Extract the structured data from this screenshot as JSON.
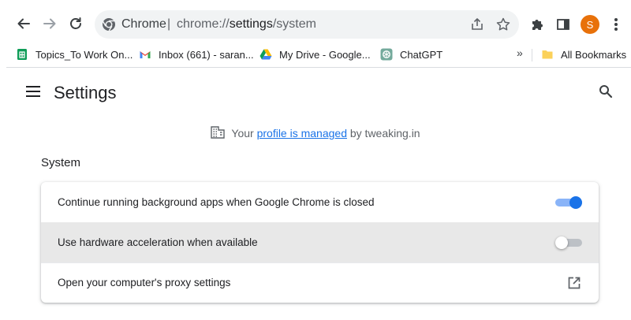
{
  "browser": {
    "omnibox": {
      "site_name": "Chrome",
      "separator": "|",
      "url_prefix": "chrome://",
      "url_host": "settings",
      "url_path": "/system"
    },
    "profile_initial": "S",
    "bookmarks": [
      {
        "label": "Topics_To Work On...",
        "icon": "google-sheets-icon"
      },
      {
        "label": "Inbox (661) - saran...",
        "icon": "gmail-icon"
      },
      {
        "label": "My Drive - Google...",
        "icon": "google-drive-icon"
      },
      {
        "label": "ChatGPT",
        "icon": "chatgpt-icon"
      }
    ],
    "bookmarks_overflow": "»",
    "all_bookmarks_label": "All Bookmarks"
  },
  "settings": {
    "title": "Settings",
    "managed_notice": {
      "prefix": "Your",
      "link": "profile is managed",
      "suffix": "by tweaking.in"
    },
    "section_title": "System",
    "rows": [
      {
        "label": "Continue running background apps when Google Chrome is closed",
        "control": "toggle",
        "enabled": true
      },
      {
        "label": "Use hardware acceleration when available",
        "control": "toggle",
        "enabled": false
      },
      {
        "label": "Open your computer's proxy settings",
        "control": "external-link"
      }
    ]
  },
  "colors": {
    "accent": "#1a73e8",
    "toggle_on_track": "#8ab4f8",
    "avatar": "#e8710a",
    "hover_row": "#e8e8e8"
  }
}
